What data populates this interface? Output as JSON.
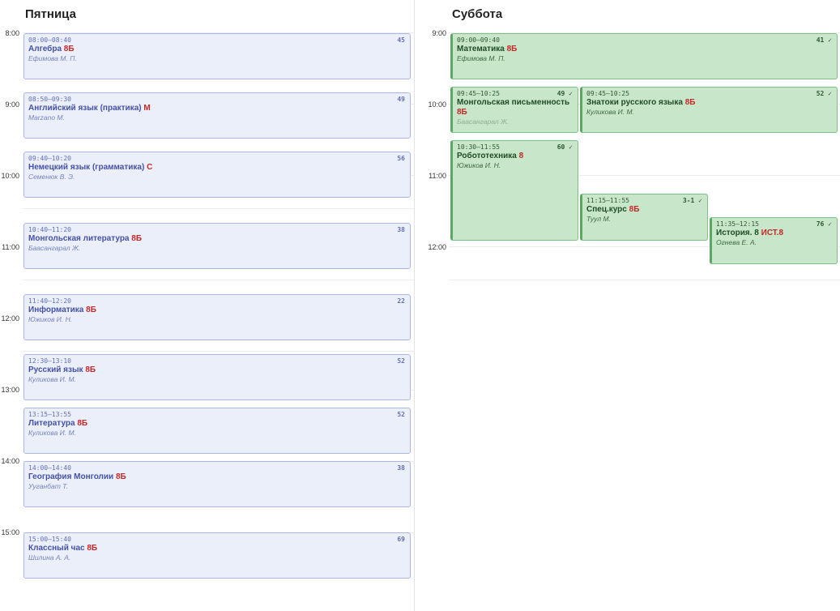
{
  "friday": {
    "title": "Пятница",
    "times": [
      "8:00",
      "9:00",
      "10:00",
      "11:00",
      "12:00",
      "13:00",
      "14:00",
      "15:00"
    ],
    "lessons": [
      {
        "time": "08:00–08:40",
        "subject": "Алгебра",
        "group": "8Б",
        "teacher": "Ефимова М. П.",
        "room": "45"
      },
      {
        "time": "08:50–09:30",
        "subject": "Английский язык (практика)",
        "group": "М",
        "teacher": "Marzano M.",
        "room": "49"
      },
      {
        "time": "09:40–10:20",
        "subject": "Немецкий язык (грамматика)",
        "group": "С",
        "teacher": "Семенюк В. Э.",
        "room": "56"
      },
      {
        "time": "10:40–11:20",
        "subject": "Монгольская литература",
        "group": "8Б",
        "teacher": "Баасангарал Ж.",
        "room": "38"
      },
      {
        "time": "11:40–12:20",
        "subject": "Информатика",
        "group": "8Б",
        "teacher": "Южиков И. Н.",
        "room": "22"
      },
      {
        "time": "12:30–13:10",
        "subject": "Русский язык",
        "group": "8Б",
        "teacher": "Куликова И. М.",
        "room": "52"
      },
      {
        "time": "13:15–13:55",
        "subject": "Литература",
        "group": "8Б",
        "teacher": "Куликова И. М.",
        "room": "52"
      },
      {
        "time": "14:00–14:40",
        "subject": "География Монголии",
        "group": "8Б",
        "teacher": "Ууганбат Т.",
        "room": "38"
      },
      {
        "time": "15:00–15:40",
        "subject": "Классный час",
        "group": "8Б",
        "teacher": "Шилина А. А.",
        "room": "69"
      }
    ]
  },
  "saturday": {
    "title": "Суббота",
    "times": [
      "9:00",
      "10:00",
      "11:00",
      "12:00"
    ],
    "lessons": [
      {
        "time": "09:00–09:40",
        "subject": "Математика",
        "group": "8Б",
        "teacher": "Ефимова М. П.",
        "room": "41 ✓"
      },
      {
        "time": "09:45–10:25",
        "subject": "Монгольская письменность",
        "group": "8Б",
        "teacher": "Баасангарал Ж.",
        "room": "49 ✓"
      },
      {
        "time": "09:45–10:25",
        "subject": "Знатоки русского языка",
        "group": "8Б",
        "teacher": "Куликова И. М.",
        "room": "52 ✓"
      },
      {
        "time": "10:30–11:55",
        "subject": "Робототехника",
        "group": "8",
        "teacher": "Южиков И. Н.",
        "room": "60 ✓"
      },
      {
        "time": "11:15–11:55",
        "subject": "Спец.курс",
        "group": "8Б",
        "teacher": "Туул М.",
        "room": "3-1 ✓"
      },
      {
        "time": "11:35–12:15",
        "subject": "История. 8",
        "group": "ИСТ.8",
        "teacher": "Огнева Е. А.",
        "room": "76 ✓"
      }
    ]
  }
}
